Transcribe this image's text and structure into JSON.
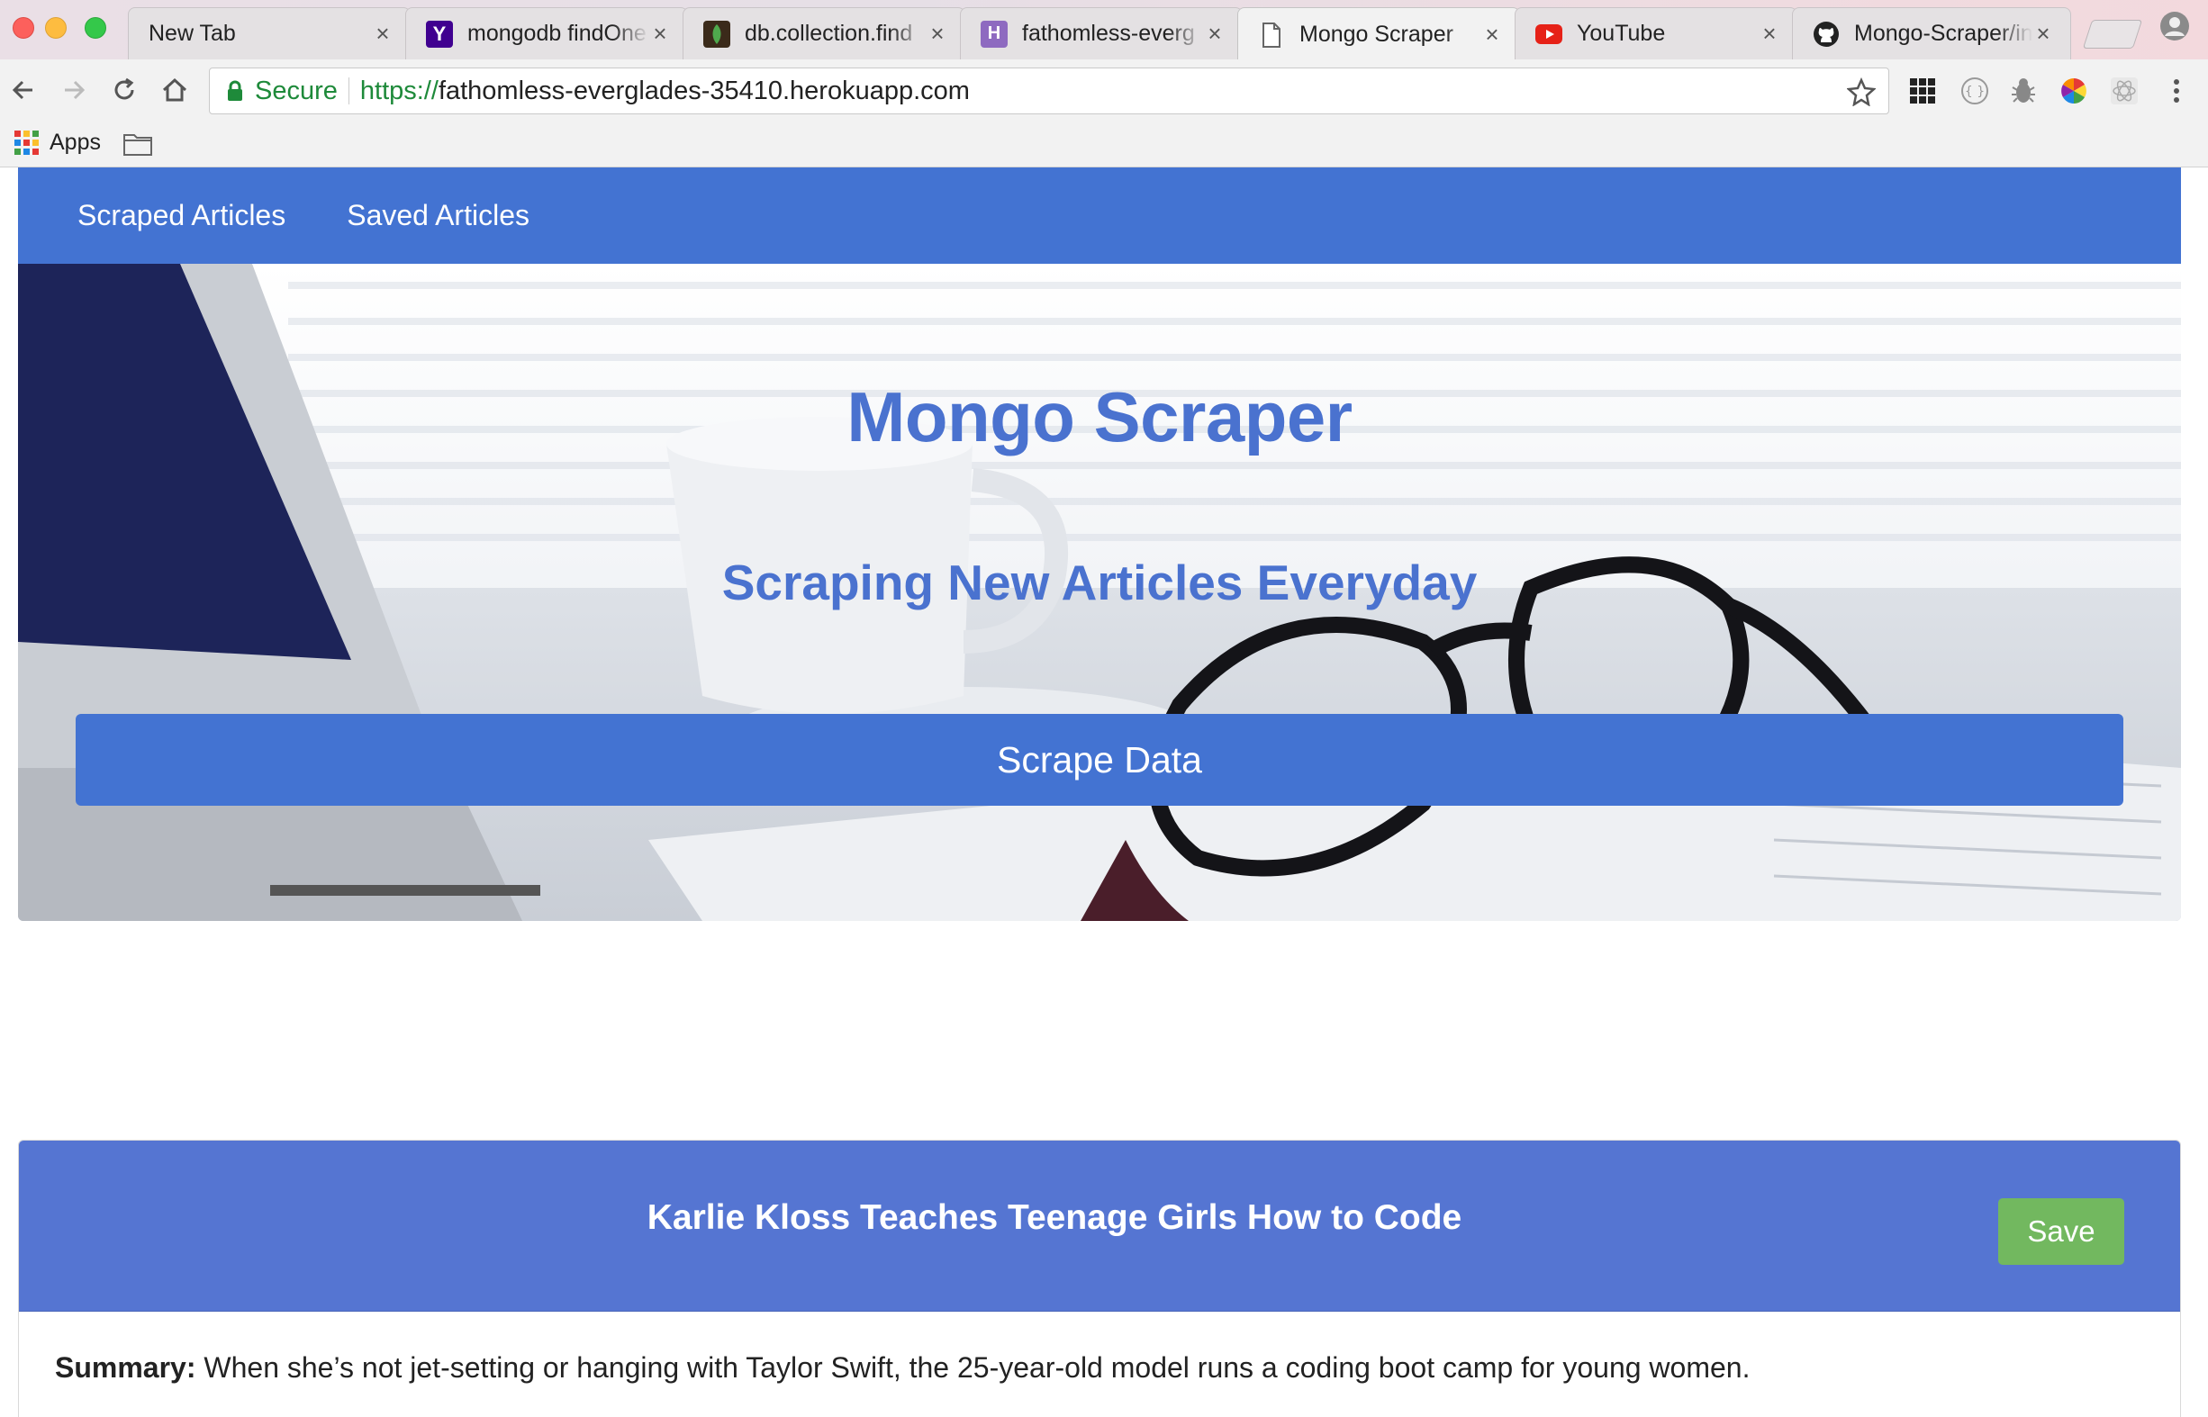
{
  "browser": {
    "tabs": [
      {
        "title": "New Tab",
        "icon": "blank-icon"
      },
      {
        "title": "mongodb findOne",
        "icon": "yahoo-icon"
      },
      {
        "title": "db.collection.find",
        "icon": "mongodb-leaf-icon"
      },
      {
        "title": "fathomless-everg",
        "icon": "heroku-icon"
      },
      {
        "title": "Mongo Scraper",
        "icon": "page-icon"
      },
      {
        "title": "YouTube",
        "icon": "youtube-icon"
      },
      {
        "title": "Mongo-Scraper/in",
        "icon": "github-icon"
      }
    ],
    "active_tab_index": 4,
    "url_badge": "Secure",
    "url_scheme": "https://",
    "url_host": "fathomless-everglades-35410.herokuapp.com",
    "bookmarks": {
      "apps_label": "Apps"
    }
  },
  "navbar": {
    "links": [
      "Scraped Articles",
      "Saved Articles"
    ],
    "color": "#4373d2"
  },
  "hero": {
    "title": "Mongo Scraper",
    "subtitle": "Scraping New Articles Everyday",
    "button_label": "Scrape Data",
    "text_color": "#4a72cf"
  },
  "articles": [
    {
      "title": "Karlie Kloss Teaches Teenage Girls How to Code",
      "save_label": "Save",
      "summary_label": "Summary:",
      "summary": "When she’s not jet-setting or hanging with Taylor Swift, the 25-year-old model runs a coding boot camp for young women."
    }
  ],
  "colors": {
    "save_button": "#72b85f",
    "card_header": "#5575d2",
    "secure_green": "#1e8a3a"
  }
}
